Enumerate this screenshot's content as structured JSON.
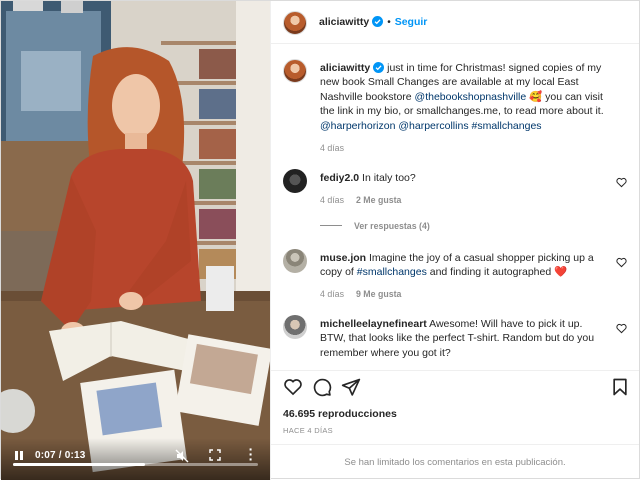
{
  "video": {
    "time": "0:07 / 0:13",
    "progress_fraction": 0.54
  },
  "header": {
    "username": "aliciawitty",
    "separator": "•",
    "follow_label": "Seguir"
  },
  "caption": {
    "username": "aliciawitty",
    "text_1": " just in time for Christmas! signed copies of my new book Small Changes are available at my local East Nashville bookstore ",
    "mention_1": "@thebookshopnashville",
    "emoji": "🥰",
    "text_2": " you can visit the link in my bio, or smallchanges.me, to read more about it. ",
    "mention_2": "@harperhorizon",
    "mention_3": "@harpercollins",
    "hashtag": "#smallchanges",
    "time": "4 días"
  },
  "comments": [
    {
      "username": "fediy2.0",
      "text": " In italy too?",
      "time": "4 días",
      "likes": "2 Me gusta",
      "replies": "Ver respuestas (4)"
    },
    {
      "username": "muse.jon",
      "text_1": " Imagine the joy of a casual shopper picking up a copy of ",
      "hashtag": "#smallchanges",
      "text_2": " and finding it autographed ",
      "emoji": "❤️",
      "time": "4 días",
      "likes": "9 Me gusta"
    },
    {
      "username": "michelleelaynefineart",
      "text": " Awesome! Will have to pick it up. BTW, that looks like the perfect T-shirt. Random but do you remember where you got it?"
    }
  ],
  "stats": {
    "views": "46.695 reproducciones",
    "ago": "HACE 4 DÍAS"
  },
  "footer": {
    "limited": "Se han limitado los comentarios en esta publicación."
  },
  "icons": [
    "verified-icon",
    "more-icon",
    "heart-icon",
    "comment-icon",
    "share-icon",
    "bookmark-icon",
    "pause-icon",
    "mute-icon",
    "fullscreen-icon"
  ],
  "colors": {
    "accent": "#0095f6",
    "link": "#00376b",
    "muted": "#8e8e8e",
    "text": "#262626",
    "heart": "#ed4956"
  }
}
